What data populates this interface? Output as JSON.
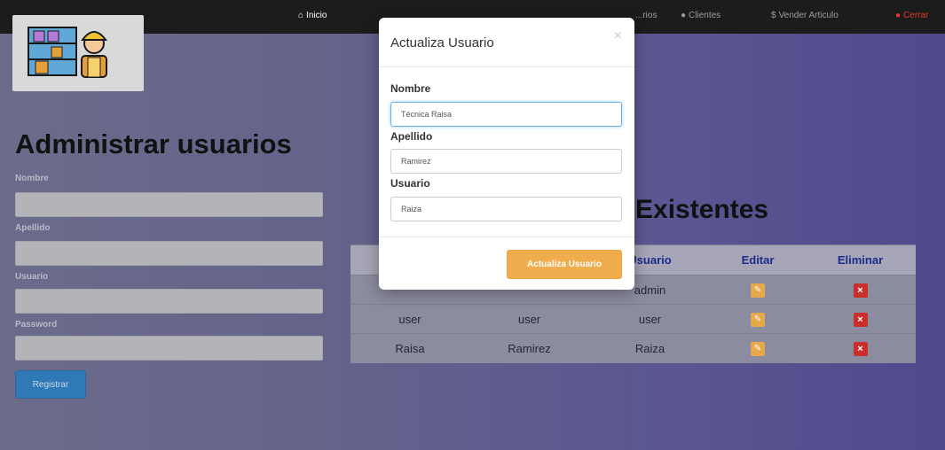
{
  "nav": {
    "items": [
      {
        "label": "Inicio",
        "icon": "home-icon"
      },
      {
        "label": "...rios",
        "icon": ""
      },
      {
        "label": "Clientes",
        "icon": "user-icon"
      },
      {
        "label": "Vender Articulo",
        "icon": "dollar-icon"
      },
      {
        "label": "Cerrar",
        "icon": "user-icon"
      }
    ]
  },
  "form": {
    "title": "Administrar usuarios",
    "labels": [
      "Nombre",
      "Apellido",
      "Usuario",
      "Password"
    ],
    "submit": "Registrar"
  },
  "table": {
    "title_partial": "Existentes",
    "headers": [
      "",
      "",
      "Usuario",
      "Editar",
      "Eliminar"
    ],
    "rows": [
      [
        "",
        "",
        "admin"
      ],
      [
        "user",
        "user",
        "user"
      ],
      [
        "Raisa",
        "Ramirez",
        "Raiza"
      ]
    ]
  },
  "modal": {
    "title": "Actualiza Usuario",
    "close": "×",
    "fields": [
      {
        "label": "Nombre",
        "value": "Técnica Raisa"
      },
      {
        "label": "Apellido",
        "value": "Ramirez"
      },
      {
        "label": "Usuario",
        "value": "Raiza"
      }
    ],
    "submit": "Actualiza Usuario"
  },
  "colors": {
    "navbar": "#1c1c1c",
    "primary_button": "#2f79b6",
    "warning_button": "#f0ad4e",
    "danger": "#c9302c"
  }
}
